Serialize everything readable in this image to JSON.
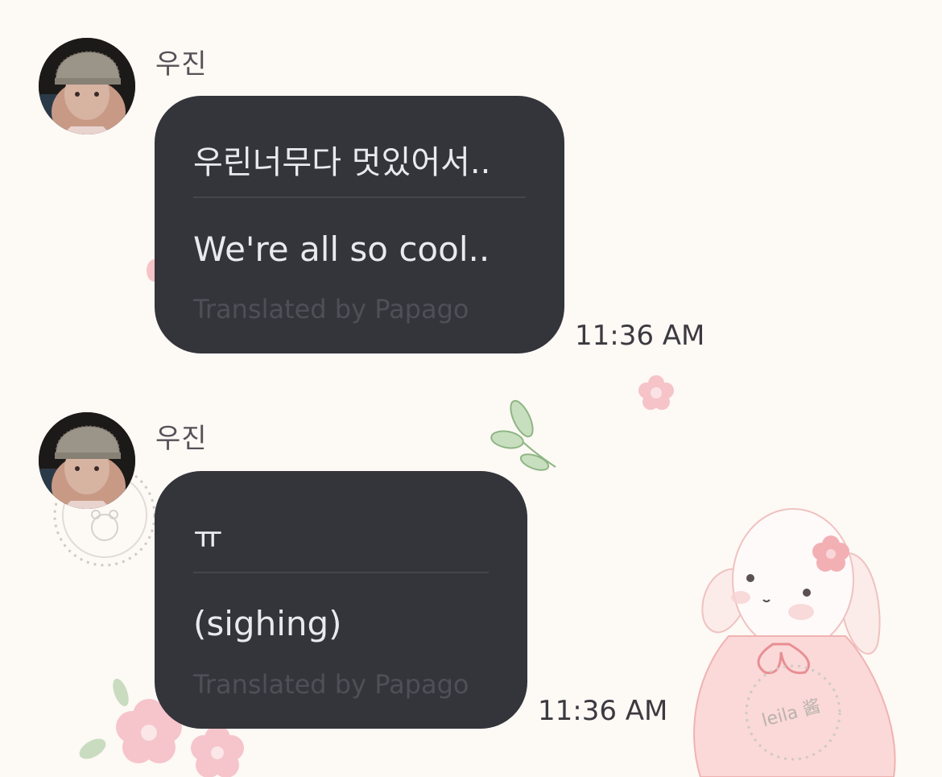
{
  "messages": [
    {
      "sender": "우진",
      "original": "우린너무다 멋있어서..",
      "translated": "We're all so cool..",
      "credit": "Translated by Papago",
      "time": "11:36 AM"
    },
    {
      "sender": "우진",
      "original": "ㅠ",
      "translated": "(sighing)",
      "credit": "Translated by Papago",
      "time": "11:36 AM"
    }
  ],
  "watermark": "leila 酱",
  "colors": {
    "background": "#fdf9f5",
    "bubble": "#34343b",
    "bubble_text": "#e9e9ee",
    "credit_text": "#4f4f58",
    "time_text": "#3b3a40",
    "flower_pink": "#f4b8c0",
    "leaf_green": "#a8c9a0"
  }
}
